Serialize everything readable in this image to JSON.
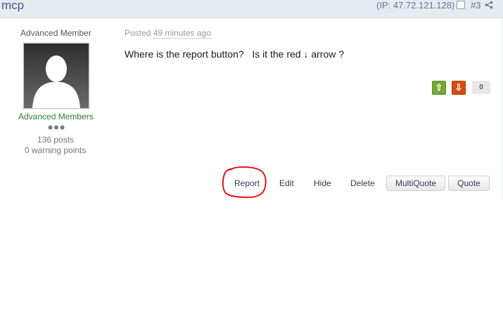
{
  "header": {
    "author": "mcp",
    "ip": "(IP: 47.72.121.128)",
    "post_number": "#3"
  },
  "author_panel": {
    "rank_title": "Advanced Member",
    "group": "Advanced Members",
    "posts": "136 posts",
    "warnings": "0 warning points"
  },
  "post": {
    "posted_prefix": "Posted",
    "posted_time": "49 minutes ago",
    "body": "Where is the report button?   Is it the red ↓ arrow ?"
  },
  "reputation": {
    "up_icon": "⇧",
    "down_icon": "⇩",
    "count": "0"
  },
  "actions": {
    "report": "Report",
    "edit": "Edit",
    "hide": "Hide",
    "delete": "Delete",
    "multiquote": "MultiQuote",
    "quote": "Quote"
  },
  "colors": {
    "header_bg": "#e6ebf2",
    "vote_up": "#72a733",
    "vote_down": "#d44c12",
    "group_name": "#2f7d32",
    "annotation": "#e00000"
  }
}
